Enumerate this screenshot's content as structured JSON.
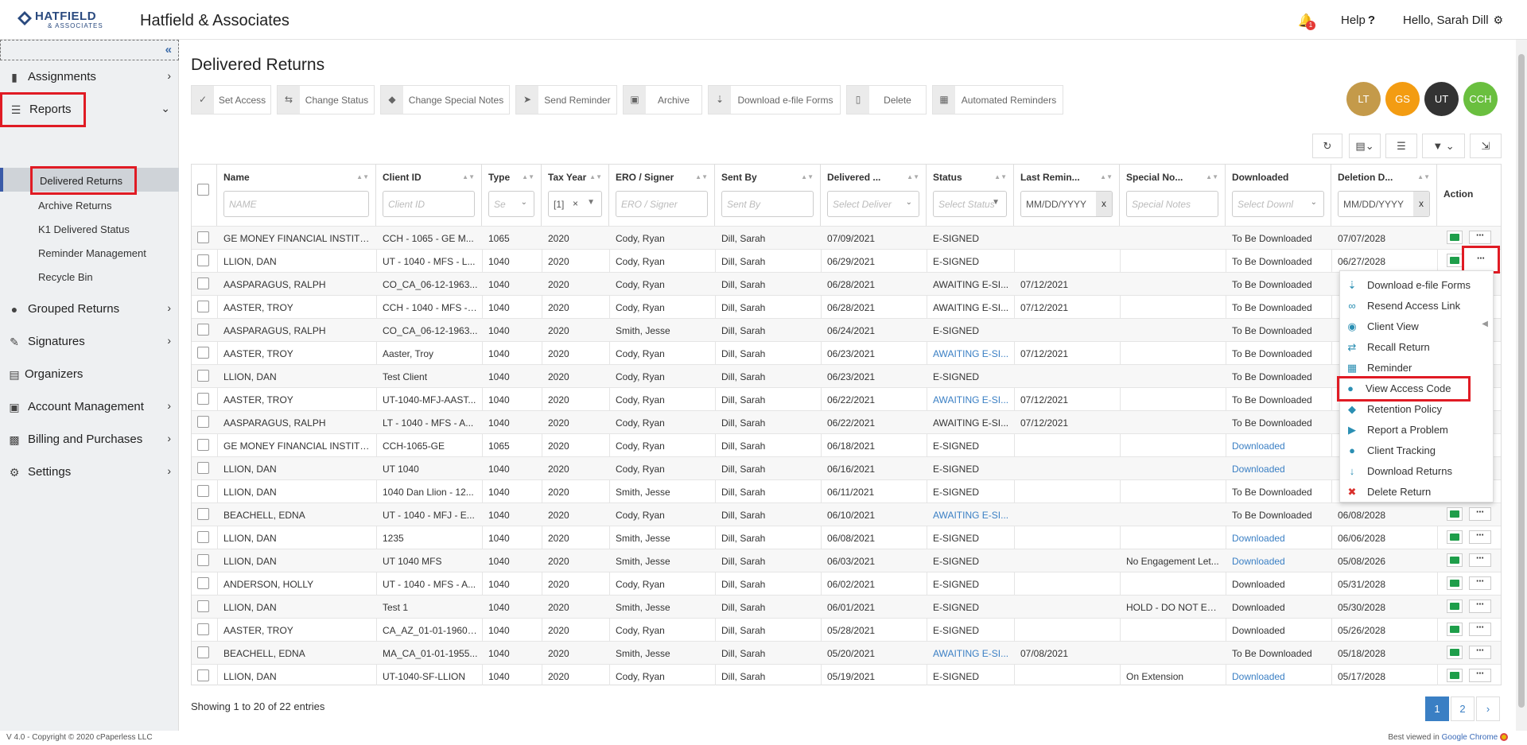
{
  "header": {
    "logo_main": "HATFIELD",
    "logo_sub": "& ASSOCIATES",
    "app_title": "Hatfield & Associates",
    "notification_count": "1",
    "help_label": "Help",
    "help_mark": "?",
    "greeting": "Hello, Sarah Dill"
  },
  "sidebar": {
    "collapse_glyph": "«",
    "items": [
      {
        "label": "Assignments",
        "icon": "clipboard-icon"
      },
      {
        "label": "Reports",
        "icon": "list-icon"
      },
      {
        "label": "Grouped Returns",
        "icon": "users-icon"
      },
      {
        "label": "Signatures",
        "icon": "signature-icon"
      },
      {
        "label": "Organizers",
        "icon": "file-icon"
      },
      {
        "label": "Account Management",
        "icon": "briefcase-icon"
      },
      {
        "label": "Billing and Purchases",
        "icon": "cart-icon"
      },
      {
        "label": "Settings",
        "icon": "gear-icon"
      }
    ],
    "reports_sub": [
      "Delivered Returns",
      "Archive Returns",
      "K1 Delivered Status",
      "Reminder Management",
      "Recycle Bin"
    ]
  },
  "page": {
    "title": "Delivered Returns",
    "toolbar": [
      "Set Access",
      "Change Status",
      "Change Special Notes",
      "Send Reminder",
      "Archive",
      "Download e-file Forms",
      "Delete",
      "Automated Reminders"
    ],
    "avatars": [
      {
        "initials": "LT",
        "color": "#c49a4a"
      },
      {
        "initials": "GS",
        "color": "#f39c12"
      },
      {
        "initials": "UT",
        "color": "#333333"
      },
      {
        "initials": "CCH",
        "color": "#6abf3f"
      }
    ]
  },
  "table": {
    "headers": [
      "Name",
      "Client ID",
      "Type",
      "Tax Year",
      "ERO / Signer",
      "Sent By",
      "Delivered ...",
      "Status",
      "Last Remin...",
      "Special No...",
      "Downloaded",
      "Deletion D...",
      "Action"
    ],
    "filters": [
      "NAME",
      "Client ID",
      "Se",
      "[1]",
      "ERO / Signer",
      "Sent By",
      "Select Deliver",
      "Select Status",
      "MM/DD/YYYY",
      "Special Notes",
      "Select Downl",
      "MM/DD/YYYY"
    ],
    "rows": [
      [
        "GE MONEY FINANCIAL INSTITUT...",
        "CCH - 1065 - GE M...",
        "1065",
        "2020",
        "Cody, Ryan",
        "Dill, Sarah",
        "07/09/2021",
        "E-SIGNED",
        "",
        "",
        "To Be Downloaded",
        "07/07/2028"
      ],
      [
        "LLION, DAN",
        "UT - 1040 - MFS - L...",
        "1040",
        "2020",
        "Cody, Ryan",
        "Dill, Sarah",
        "06/29/2021",
        "E-SIGNED",
        "",
        "",
        "To Be Downloaded",
        "06/27/2028"
      ],
      [
        "AASPARAGUS, RALPH",
        "CO_CA_06-12-1963...",
        "1040",
        "2020",
        "Cody, Ryan",
        "Dill, Sarah",
        "06/28/2021",
        "AWAITING E-SI...",
        "07/12/2021",
        "",
        "To Be Downloaded",
        ""
      ],
      [
        "AASTER, TROY",
        "CCH - 1040 - MFS - ...",
        "1040",
        "2020",
        "Cody, Ryan",
        "Dill, Sarah",
        "06/28/2021",
        "AWAITING E-SI...",
        "07/12/2021",
        "",
        "To Be Downloaded",
        ""
      ],
      [
        "AASPARAGUS, RALPH",
        "CO_CA_06-12-1963...",
        "1040",
        "2020",
        "Smith, Jesse",
        "Dill, Sarah",
        "06/24/2021",
        "E-SIGNED",
        "",
        "",
        "To Be Downloaded",
        ""
      ],
      [
        "AASTER, TROY",
        "Aaster, Troy",
        "1040",
        "2020",
        "Cody, Ryan",
        "Dill, Sarah",
        "06/23/2021",
        "AWAITING E-SI...",
        "07/12/2021",
        "",
        "To Be Downloaded",
        ""
      ],
      [
        "LLION, DAN",
        "Test Client",
        "1040",
        "2020",
        "Cody, Ryan",
        "Dill, Sarah",
        "06/23/2021",
        "E-SIGNED",
        "",
        "",
        "To Be Downloaded",
        ""
      ],
      [
        "AASTER, TROY",
        "UT-1040-MFJ-AAST...",
        "1040",
        "2020",
        "Cody, Ryan",
        "Dill, Sarah",
        "06/22/2021",
        "AWAITING E-SI...",
        "07/12/2021",
        "",
        "To Be Downloaded",
        ""
      ],
      [
        "AASPARAGUS, RALPH",
        "LT - 1040 - MFS - A...",
        "1040",
        "2020",
        "Cody, Ryan",
        "Dill, Sarah",
        "06/22/2021",
        "AWAITING E-SI...",
        "07/12/2021",
        "",
        "To Be Downloaded",
        ""
      ],
      [
        "GE MONEY FINANCIAL INSTITUT...",
        "CCH-1065-GE",
        "1065",
        "2020",
        "Cody, Ryan",
        "Dill, Sarah",
        "06/18/2021",
        "E-SIGNED",
        "",
        "",
        "Downloaded",
        ""
      ],
      [
        "LLION, DAN",
        "UT 1040",
        "1040",
        "2020",
        "Cody, Ryan",
        "Dill, Sarah",
        "06/16/2021",
        "E-SIGNED",
        "",
        "",
        "Downloaded",
        ""
      ],
      [
        "LLION, DAN",
        "1040 Dan Llion - 12...",
        "1040",
        "2020",
        "Smith, Jesse",
        "Dill, Sarah",
        "06/11/2021",
        "E-SIGNED",
        "",
        "",
        "To Be Downloaded",
        ""
      ],
      [
        "BEACHELL, EDNA",
        "UT - 1040 - MFJ - E...",
        "1040",
        "2020",
        "Cody, Ryan",
        "Dill, Sarah",
        "06/10/2021",
        "AWAITING E-SI...",
        "",
        "",
        "To Be Downloaded",
        "06/08/2028"
      ],
      [
        "LLION, DAN",
        "1235",
        "1040",
        "2020",
        "Smith, Jesse",
        "Dill, Sarah",
        "06/08/2021",
        "E-SIGNED",
        "",
        "",
        "Downloaded",
        "06/06/2028"
      ],
      [
        "LLION, DAN",
        "UT 1040 MFS",
        "1040",
        "2020",
        "Smith, Jesse",
        "Dill, Sarah",
        "06/03/2021",
        "E-SIGNED",
        "",
        "No Engagement Let...",
        "Downloaded",
        "05/08/2026"
      ],
      [
        "ANDERSON, HOLLY",
        "UT - 1040 - MFS - A...",
        "1040",
        "2020",
        "Cody, Ryan",
        "Dill, Sarah",
        "06/02/2021",
        "E-SIGNED",
        "",
        "",
        "Downloaded",
        "05/31/2028"
      ],
      [
        "LLION, DAN",
        "Test 1",
        "1040",
        "2020",
        "Smith, Jesse",
        "Dill, Sarah",
        "06/01/2021",
        "E-SIGNED",
        "",
        "HOLD - DO NOT EFI...",
        "Downloaded",
        "05/30/2028"
      ],
      [
        "AASTER, TROY",
        "CA_AZ_01-01-1960_...",
        "1040",
        "2020",
        "Cody, Ryan",
        "Dill, Sarah",
        "05/28/2021",
        "E-SIGNED",
        "",
        "",
        "Downloaded",
        "05/26/2028"
      ],
      [
        "BEACHELL, EDNA",
        "MA_CA_01-01-1955...",
        "1040",
        "2020",
        "Smith, Jesse",
        "Dill, Sarah",
        "05/20/2021",
        "AWAITING E-SI...",
        "07/08/2021",
        "",
        "To Be Downloaded",
        "05/18/2028"
      ],
      [
        "LLION, DAN",
        "UT-1040-SF-LLION",
        "1040",
        "2020",
        "Cody, Ryan",
        "Dill, Sarah",
        "05/19/2021",
        "E-SIGNED",
        "",
        "On Extension",
        "Downloaded",
        "05/17/2028"
      ]
    ],
    "link_status_rows": [
      5,
      7,
      12,
      18
    ],
    "link_downloaded_rows": [
      9,
      10,
      13,
      14,
      19
    ]
  },
  "action_menu": [
    {
      "label": "Download e-file Forms",
      "icon": "file-download-icon"
    },
    {
      "label": "Resend Access Link",
      "icon": "link-icon"
    },
    {
      "label": "Client View",
      "icon": "eye-icon"
    },
    {
      "label": "Recall Return",
      "icon": "recall-icon"
    },
    {
      "label": "Reminder",
      "icon": "calendar-icon"
    },
    {
      "label": "View Access Code",
      "icon": "user-key-icon"
    },
    {
      "label": "Retention Policy",
      "icon": "shield-icon"
    },
    {
      "label": "Report a Problem",
      "icon": "megaphone-icon"
    },
    {
      "label": "Client Tracking",
      "icon": "user-tracking-icon"
    },
    {
      "label": "Download Returns",
      "icon": "download-icon"
    },
    {
      "label": "Delete Return",
      "icon": "delete-icon"
    }
  ],
  "footer": {
    "info": "Showing 1 to 20 of 22 entries",
    "pages": [
      "1",
      "2"
    ],
    "copyright": "V 4.0 - Copyright © 2020 cPaperless LLC",
    "best_viewed": "Best viewed in",
    "browser": "Google Chrome"
  }
}
